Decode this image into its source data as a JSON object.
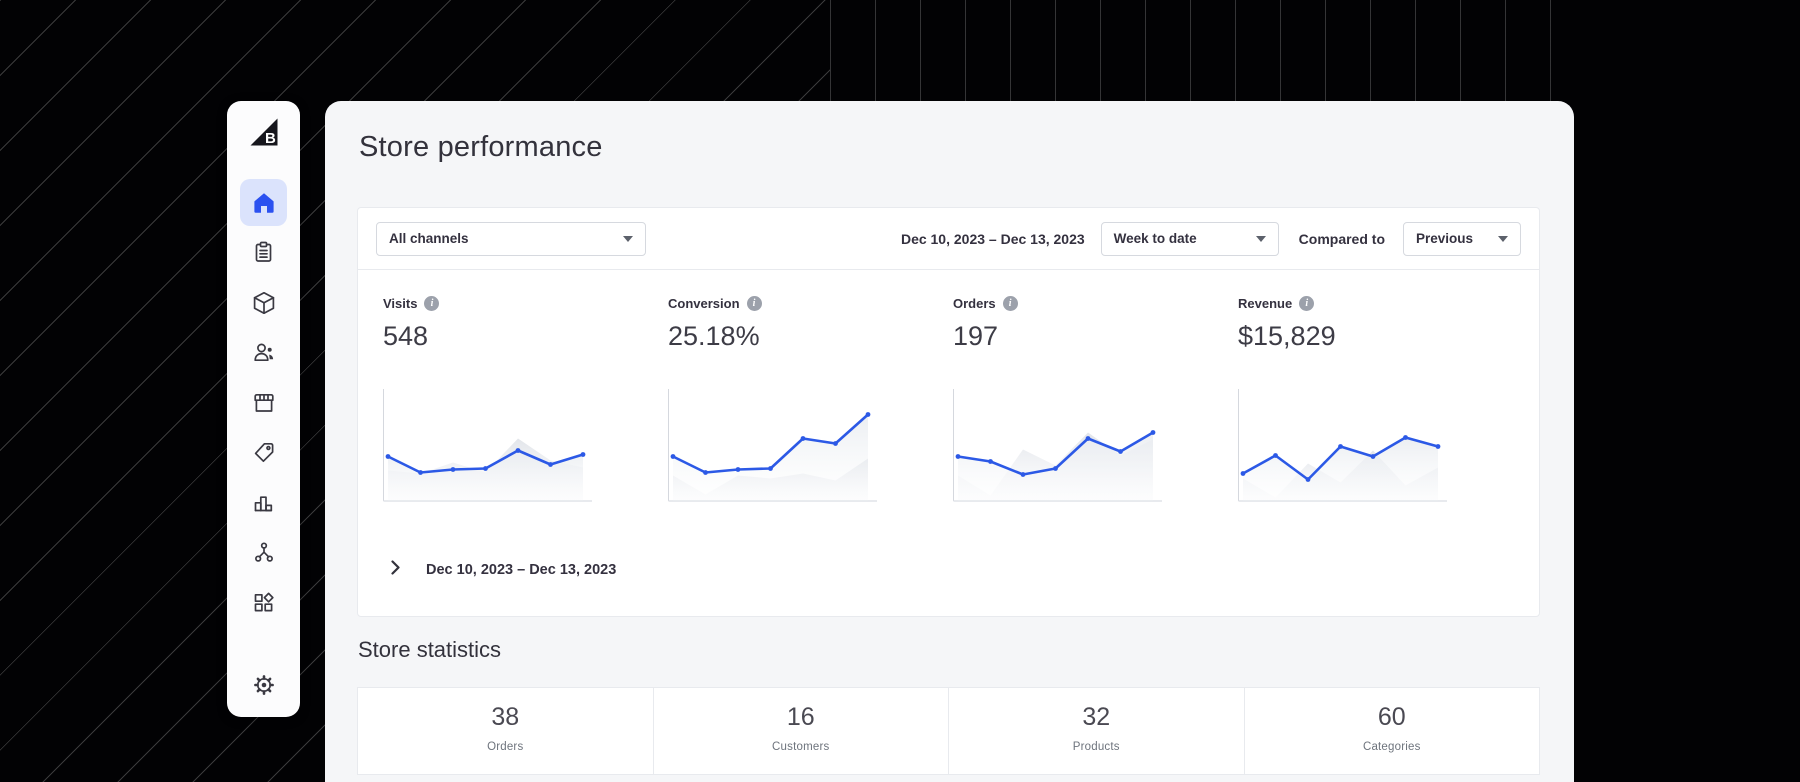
{
  "colors": {
    "accent_blue": "#2b51f0",
    "chart_line_blue": "#2c59e6",
    "active_nav_bg": "#dbe3fc",
    "panel_bg": "#f5f6f8",
    "card_border": "#e8eaee"
  },
  "sidebar": {
    "logo": "bigcommerce-logo",
    "items": [
      {
        "id": "home",
        "icon": "home-icon",
        "active": true
      },
      {
        "id": "orders",
        "icon": "clipboard-icon",
        "active": false
      },
      {
        "id": "products",
        "icon": "cube-icon",
        "active": false
      },
      {
        "id": "customers",
        "icon": "customers-icon",
        "active": false
      },
      {
        "id": "storefront",
        "icon": "storefront-icon",
        "active": false
      },
      {
        "id": "marketing",
        "icon": "tag-icon",
        "active": false
      },
      {
        "id": "analytics",
        "icon": "bar-chart-icon",
        "active": false
      },
      {
        "id": "channels",
        "icon": "share-nodes-icon",
        "active": false
      },
      {
        "id": "apps",
        "icon": "apps-grid-icon",
        "active": false
      },
      {
        "id": "settings",
        "icon": "gear-icon",
        "active": false
      }
    ]
  },
  "header": {
    "title": "Store performance"
  },
  "filters": {
    "channel_select": {
      "value": "All channels"
    },
    "date_range": "Dec 10, 2023 – Dec 13, 2023",
    "period_select": {
      "value": "Week to date"
    },
    "compared_to_label": "Compared to",
    "compare_select": {
      "value": "Previous"
    }
  },
  "metrics": [
    {
      "label": "Visits",
      "value": "548",
      "chart": {
        "current": [
          44,
          28,
          31,
          32,
          50,
          36,
          46
        ],
        "previous": [
          30,
          27,
          38,
          28,
          62,
          40,
          33
        ]
      }
    },
    {
      "label": "Conversion",
      "value": "25.18%",
      "chart": {
        "current": [
          44,
          28,
          31,
          32,
          62,
          57,
          86
        ],
        "previous": [
          25,
          6,
          25,
          22,
          27,
          20,
          42
        ]
      }
    },
    {
      "label": "Orders",
      "value": "197",
      "chart": {
        "current": [
          44,
          39,
          26,
          32,
          62,
          49,
          68
        ],
        "previous": [
          25,
          5,
          51,
          35,
          68,
          45,
          61
        ]
      }
    },
    {
      "label": "Revenue",
      "value": "$15,829",
      "chart": {
        "current": [
          27,
          45,
          21,
          54,
          44,
          63,
          54
        ],
        "previous": [
          22,
          3,
          37,
          18,
          50,
          15,
          33
        ]
      }
    }
  ],
  "expander": {
    "label": "Dec 10, 2023 – Dec 13, 2023"
  },
  "statistics": {
    "title": "Store statistics",
    "items": [
      {
        "value": "38",
        "label": "Orders"
      },
      {
        "value": "16",
        "label": "Customers"
      },
      {
        "value": "32",
        "label": "Products"
      },
      {
        "value": "60",
        "label": "Categories"
      }
    ]
  },
  "chart_data": [
    {
      "type": "line",
      "name": "Visits sparkline",
      "y_normalized_0_100": true,
      "series": [
        {
          "name": "current period",
          "color": "#2c59e6",
          "values": [
            44,
            28,
            31,
            32,
            50,
            36,
            46
          ]
        },
        {
          "name": "previous period (area)",
          "color": "#e4e7ec",
          "values": [
            30,
            27,
            38,
            28,
            62,
            40,
            33
          ]
        }
      ]
    },
    {
      "type": "line",
      "name": "Conversion sparkline",
      "y_normalized_0_100": true,
      "series": [
        {
          "name": "current period",
          "color": "#2c59e6",
          "values": [
            44,
            28,
            31,
            32,
            62,
            57,
            86
          ]
        },
        {
          "name": "previous period (area)",
          "color": "#e4e7ec",
          "values": [
            25,
            6,
            25,
            22,
            27,
            20,
            42
          ]
        }
      ]
    },
    {
      "type": "line",
      "name": "Orders sparkline",
      "y_normalized_0_100": true,
      "series": [
        {
          "name": "current period",
          "color": "#2c59e6",
          "values": [
            44,
            39,
            26,
            32,
            62,
            49,
            68
          ]
        },
        {
          "name": "previous period (area)",
          "color": "#e4e7ec",
          "values": [
            25,
            5,
            51,
            35,
            68,
            45,
            61
          ]
        }
      ]
    },
    {
      "type": "line",
      "name": "Revenue sparkline",
      "y_normalized_0_100": true,
      "series": [
        {
          "name": "current period",
          "color": "#2c59e6",
          "values": [
            27,
            45,
            21,
            54,
            44,
            63,
            54
          ]
        },
        {
          "name": "previous period (area)",
          "color": "#e4e7ec",
          "values": [
            22,
            3,
            37,
            18,
            50,
            15,
            33
          ]
        }
      ]
    }
  ]
}
